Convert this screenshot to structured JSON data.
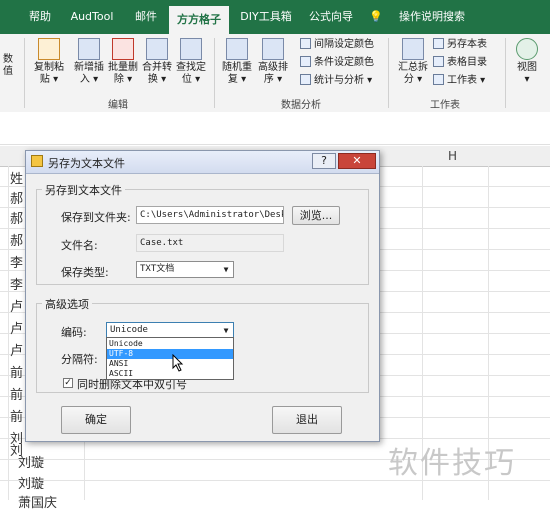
{
  "ribbon": {
    "tabs": [
      "帮助",
      "AudTool",
      "邮件",
      "方方格子",
      "DIY工具箱",
      "公式向导",
      "操作说明搜索"
    ],
    "active_tab": "方方格子",
    "left_cut": "数值",
    "edit_group": {
      "label": "编辑",
      "buttons": [
        {
          "line1": "复制粘",
          "line2": "贴 ▾"
        },
        {
          "line1": "新增插",
          "line2": "入 ▾"
        },
        {
          "line1": "批量删",
          "line2": "除 ▾"
        },
        {
          "line1": "合并转",
          "line2": "换 ▾"
        },
        {
          "line1": "查找定",
          "line2": "位 ▾"
        }
      ]
    },
    "analysis_group": {
      "label": "数据分析",
      "buttons": [
        {
          "line1": "随机重",
          "line2": "复 ▾"
        },
        {
          "line1": "高级排",
          "line2": "序 ▾"
        }
      ],
      "small": [
        "间隔设定颜色",
        "条件设定颜色",
        "统计与分析 ▾"
      ]
    },
    "worksheet_group": {
      "label": "工作表",
      "button": {
        "line1": "汇总拆",
        "line2": "分 ▾"
      },
      "small": [
        "另存本表",
        "表格目录",
        "工作表 ▾"
      ]
    },
    "view_group": {
      "label": "视图",
      "arrow": "▾"
    }
  },
  "sheet": {
    "column_h": "H",
    "cells_left": [
      "姓",
      "郝",
      "郝",
      "郝",
      "李",
      "李",
      "卢",
      "卢",
      "卢",
      "前",
      "前",
      "前",
      "刘",
      "刘"
    ],
    "cells_bottom": [
      "刘璇",
      "刘璇",
      "萧国庆"
    ]
  },
  "dialog": {
    "title": "另存为文本文件",
    "help_btn": "?",
    "close_btn": "✕",
    "section1": "另存到文本文件",
    "folder_label": "保存到文件夹:",
    "folder_value": "C:\\Users\\Administrator\\Deskto",
    "browse_label": "浏览...",
    "filename_label": "文件名:",
    "filename_value": "Case.txt",
    "type_label": "保存类型:",
    "type_value": "TXT文档",
    "section2": "高级选项",
    "encoding_label": "编码:",
    "encoding_value": "Unicode",
    "encoding_options": [
      "Unicode",
      "UTF-8",
      "ANSI",
      "ASCII"
    ],
    "encoding_selected": "UTF-8",
    "delimiter_label": "分隔符:",
    "checkbox_label": "同时删除文本中双引号",
    "checkbox_checked": true,
    "ok_label": "确定",
    "exit_label": "退出"
  },
  "watermark": "软件技巧"
}
